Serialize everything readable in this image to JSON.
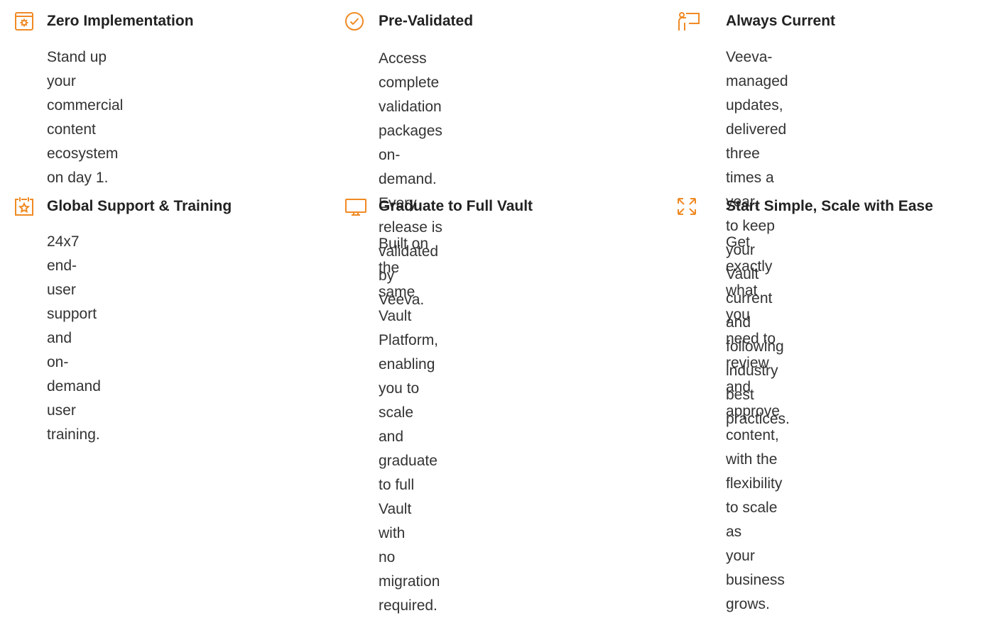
{
  "accent_color": "#f08a24",
  "features": [
    {
      "icon": "settings-gear-icon",
      "title": "Zero Implementation",
      "description": "Stand up your commercial\ncontent ecosystem on day 1."
    },
    {
      "icon": "check-circle-icon",
      "title": "Pre-Validated",
      "description": "Access complete validation\npackages on-demand. Every\nrelease is validated by Veeva."
    },
    {
      "icon": "presenter-icon",
      "title": "Always Current",
      "description": "Veeva-managed updates,\ndelivered three times a year,\nto keep your Vault current and\nfollowing industry best practices."
    },
    {
      "icon": "star-calendar-icon",
      "title": "Global Support & Training",
      "description": "24x7 end-user support and\non-demand user training."
    },
    {
      "icon": "monitor-icon",
      "title": "Graduate to Full Vault",
      "description": "Built on the same Vault\nPlatform, enabling you to scale\nand graduate to full Vault with\nno migration required."
    },
    {
      "icon": "expand-arrows-icon",
      "title": "Start Simple, Scale with Ease",
      "description": "Get exactly what you need to\nreview and approve content,\nwith the flexibility to scale as\nyour business grows."
    }
  ]
}
